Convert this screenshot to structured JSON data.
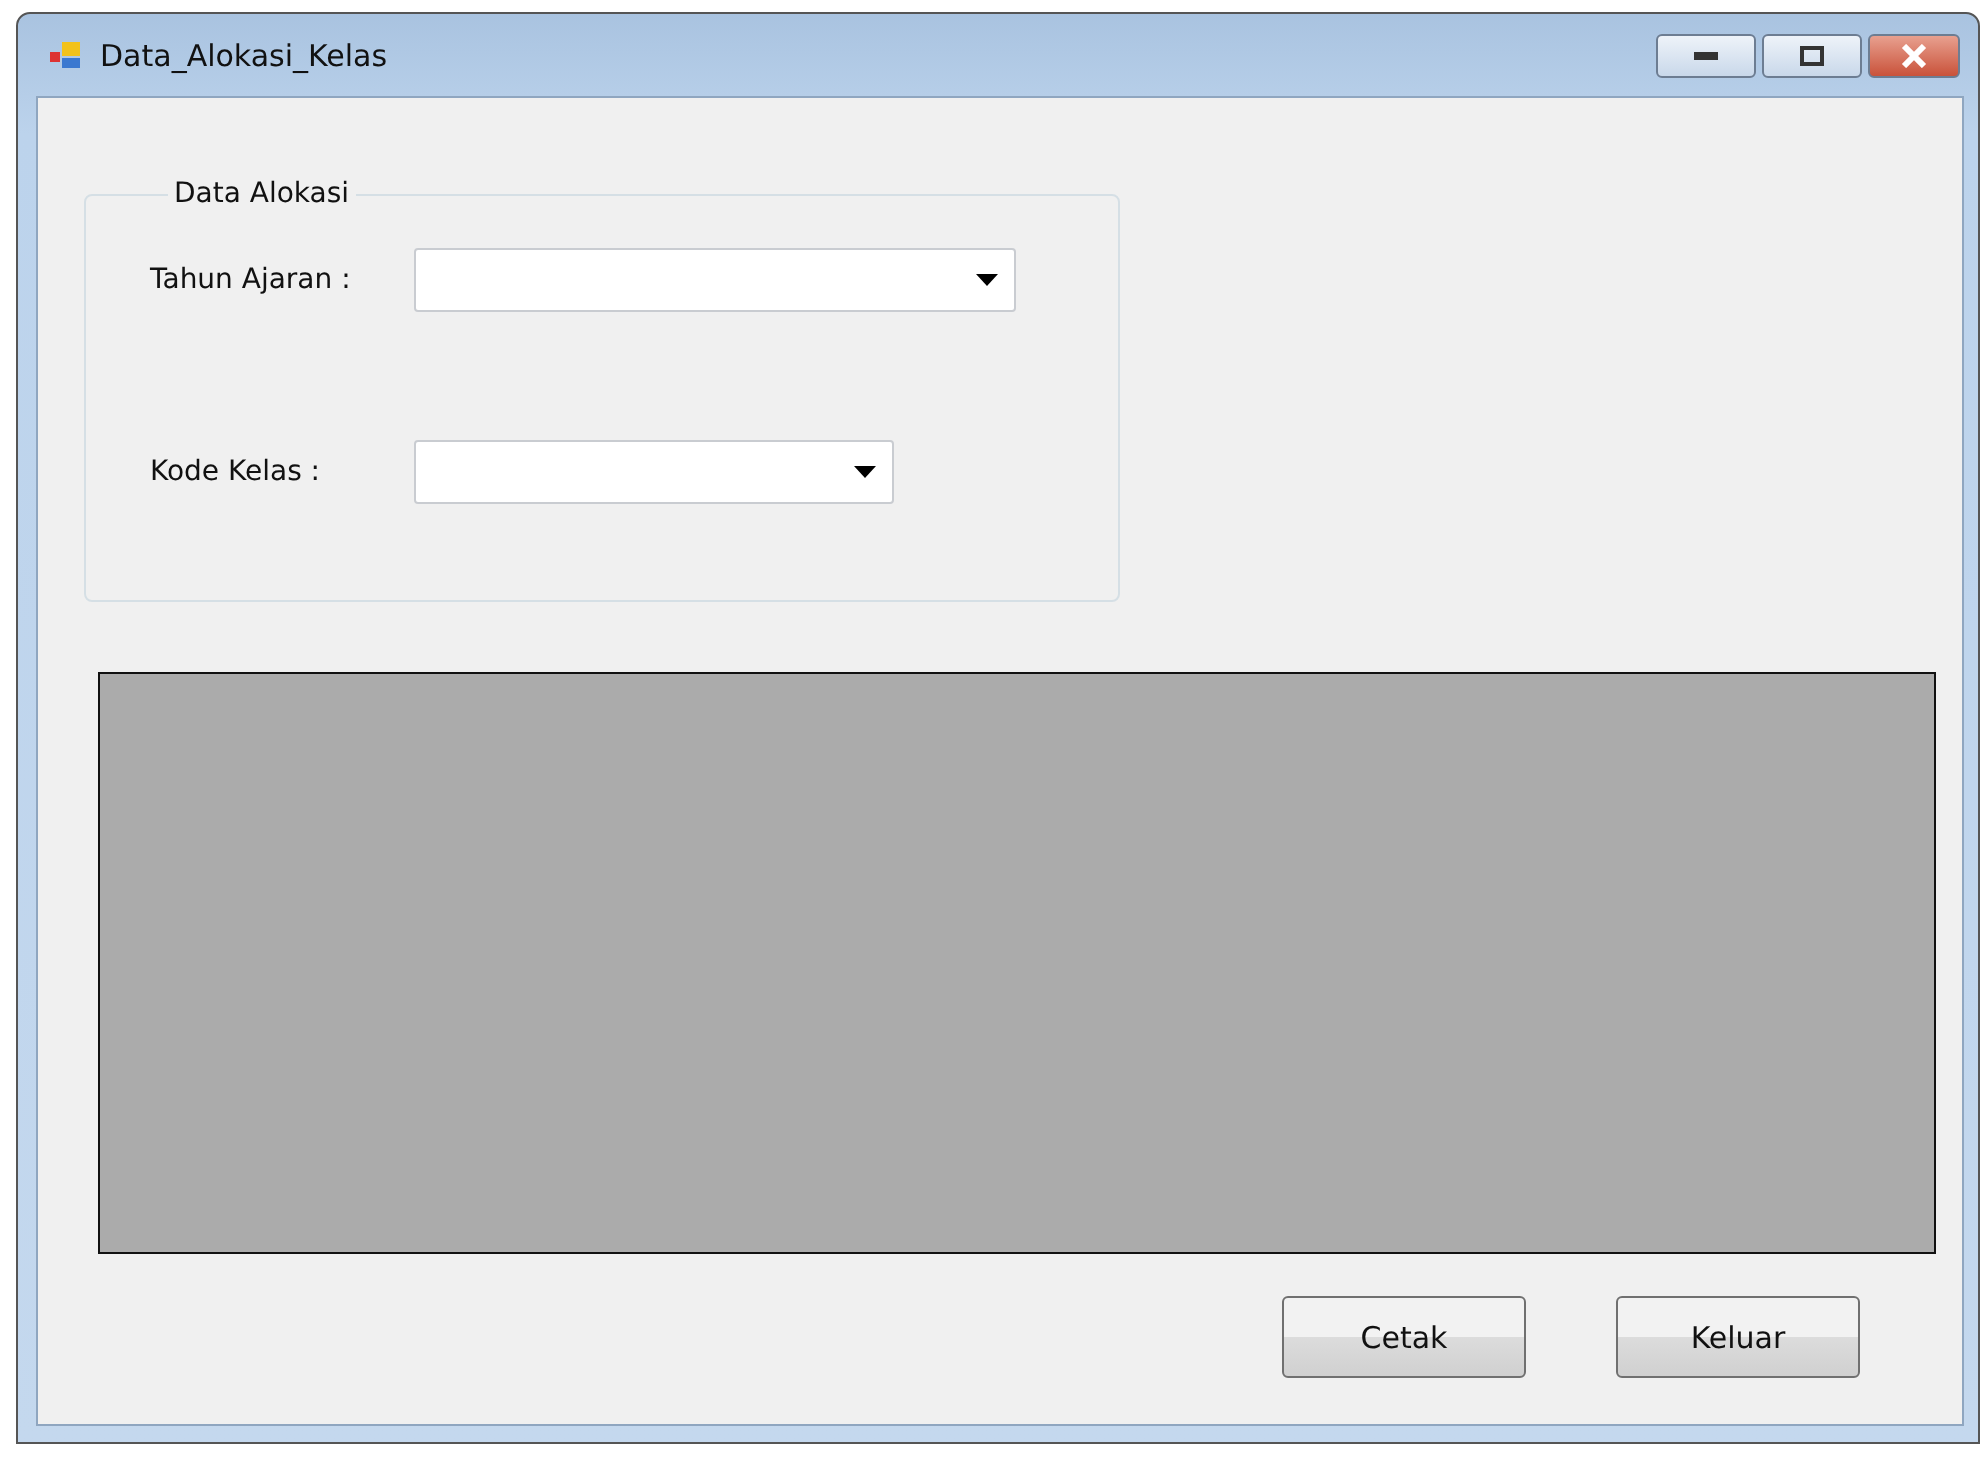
{
  "window": {
    "title": "Data_Alokasi_Kelas"
  },
  "group": {
    "title": "Data Alokasi",
    "fields": [
      {
        "label": "Tahun Ajaran :"
      },
      {
        "label": "Kode Kelas :"
      }
    ]
  },
  "buttons": [
    "Cetak",
    "Keluar"
  ]
}
